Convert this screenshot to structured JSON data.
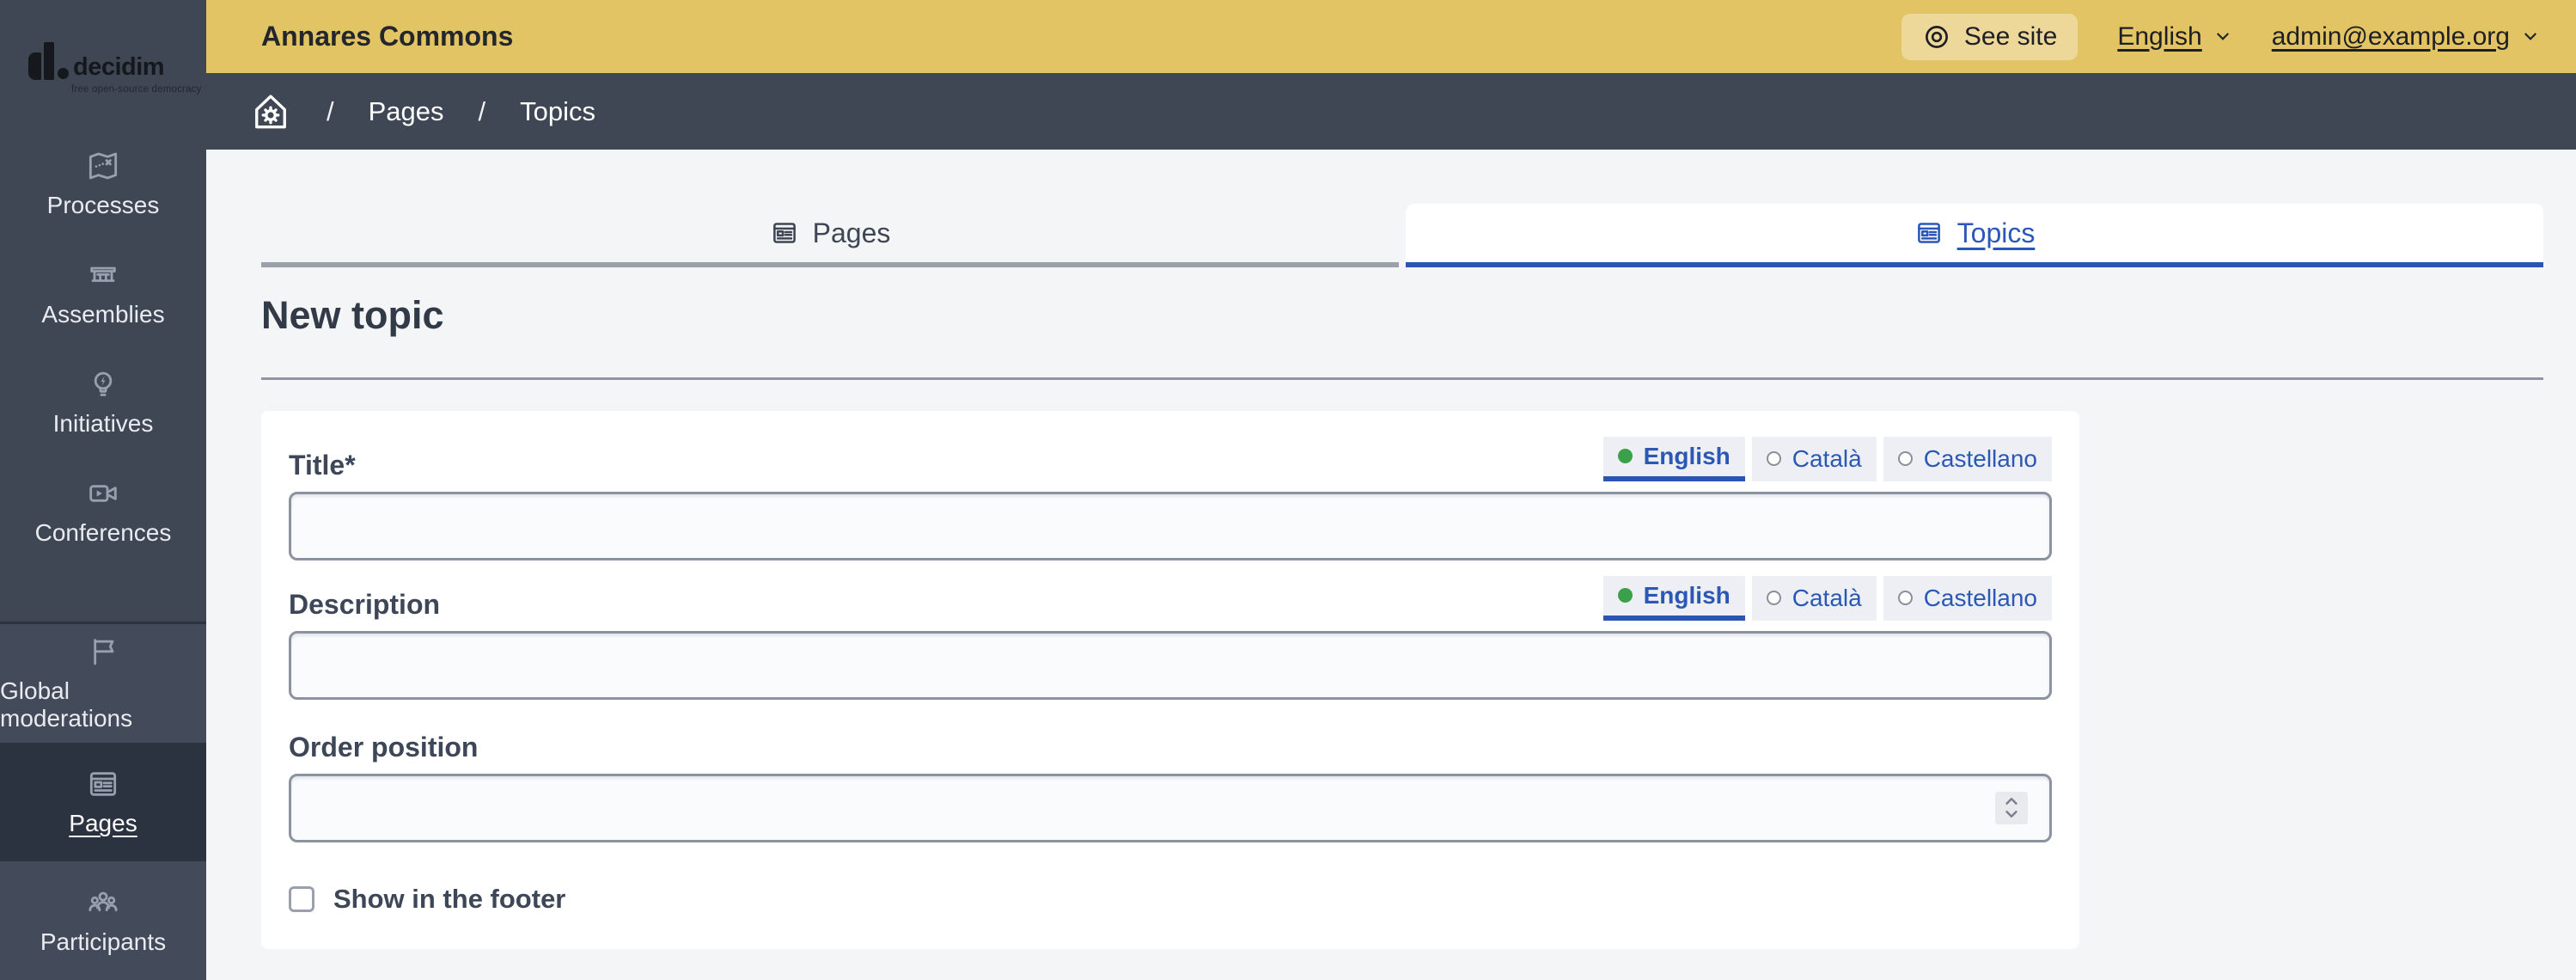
{
  "logo": {
    "wordmark": "decidim",
    "tagline": "free open-source democracy"
  },
  "topbar": {
    "site_title": "Annares Commons",
    "see_site": "See site",
    "language": "English",
    "account": "admin@example.org"
  },
  "breadcrumb": {
    "separator": "/",
    "items": [
      "Pages",
      "Topics"
    ]
  },
  "sidebar": {
    "primary": [
      {
        "label": "Processes",
        "icon": "process-map-icon"
      },
      {
        "label": "Assemblies",
        "icon": "assembly-building-icon"
      },
      {
        "label": "Initiatives",
        "icon": "initiative-bulb-icon"
      },
      {
        "label": "Conferences",
        "icon": "conference-video-icon"
      }
    ],
    "secondary": [
      {
        "label": "Global moderations",
        "icon": "moderation-flag-icon",
        "active": false
      },
      {
        "label": "Pages",
        "icon": "pages-article-icon",
        "active": true
      },
      {
        "label": "Participants",
        "icon": "participants-group-icon",
        "active": false
      }
    ]
  },
  "tabs": [
    {
      "label": "Pages",
      "icon": "article-icon",
      "active": false
    },
    {
      "label": "Topics",
      "icon": "article-icon",
      "active": true
    }
  ],
  "content": {
    "heading": "New topic"
  },
  "form": {
    "language_options": [
      {
        "label": "English",
        "selected": true
      },
      {
        "label": "Català",
        "selected": false
      },
      {
        "label": "Castellano",
        "selected": false
      }
    ],
    "fields": {
      "title": {
        "label": "Title*",
        "value": ""
      },
      "description": {
        "label": "Description",
        "value": ""
      },
      "order": {
        "label": "Order position",
        "value": ""
      }
    },
    "footer_checkbox": {
      "label": "Show in the footer",
      "checked": false
    }
  },
  "colors": {
    "topbar_yellow": "#e3c464",
    "nav_slate": "#3f4755",
    "nav_active": "#2b3240",
    "accent_blue": "#2a55b2",
    "link_blue": "#2b58b3",
    "selected_green": "#3ba04a",
    "page_bg": "#f4f5f7",
    "card_bg": "#ffffff",
    "input_border": "#8b93a0",
    "inactive_tab_border": "#9aa1ab"
  }
}
